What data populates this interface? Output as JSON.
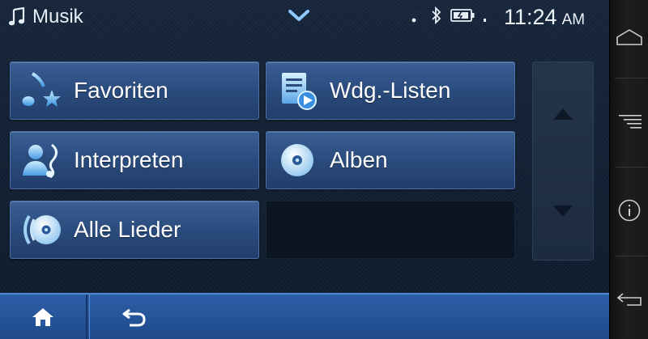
{
  "status_bar": {
    "app_title": "Musik",
    "icons": [
      "music-note-icon",
      "chevron-down-icon",
      "wifi-icon",
      "bluetooth-icon",
      "battery-icon",
      "signal-icon"
    ],
    "time": "11:24",
    "ampm": "AM"
  },
  "menu": {
    "items": [
      {
        "label": "Favoriten",
        "icon": "music-star-icon"
      },
      {
        "label": "Wdg.-Listen",
        "icon": "playlist-icon"
      },
      {
        "label": "Interpreten",
        "icon": "artist-icon"
      },
      {
        "label": "Alben",
        "icon": "album-disc-icon"
      },
      {
        "label": "Alle Lieder",
        "icon": "all-songs-icon"
      }
    ]
  },
  "scroll": {
    "up_icon": "triangle-up-icon",
    "down_icon": "triangle-down-icon"
  },
  "bottom_bar": {
    "home_icon": "home-icon",
    "back_icon": "back-arrow-icon"
  },
  "system_buttons": [
    "home-outline-icon",
    "menu-lines-icon",
    "info-icon",
    "return-icon"
  ],
  "colors": {
    "accent": "#2b4c7e",
    "bottom_bar": "#2d5ea6",
    "background": "#16253a"
  }
}
